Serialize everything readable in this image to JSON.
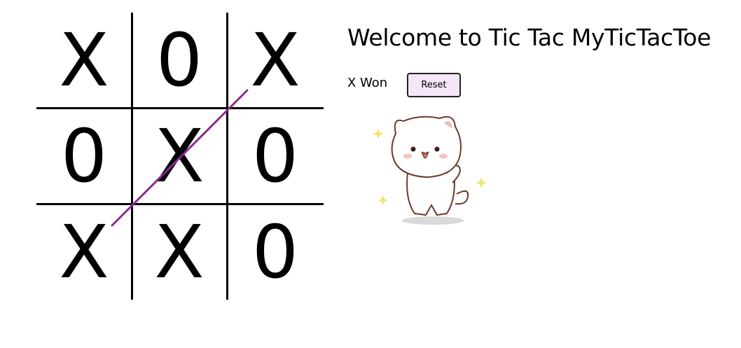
{
  "game": {
    "title": "Welcome to Tic Tac MyTicTacToe",
    "status": "X Won",
    "reset_label": "Reset",
    "board": [
      "X",
      "0",
      "X",
      "0",
      "X",
      "0",
      "X",
      "X",
      "0"
    ],
    "winning_line": "diagonal from bottom-left to top-right",
    "win_line_color": "#8b2a8e"
  }
}
